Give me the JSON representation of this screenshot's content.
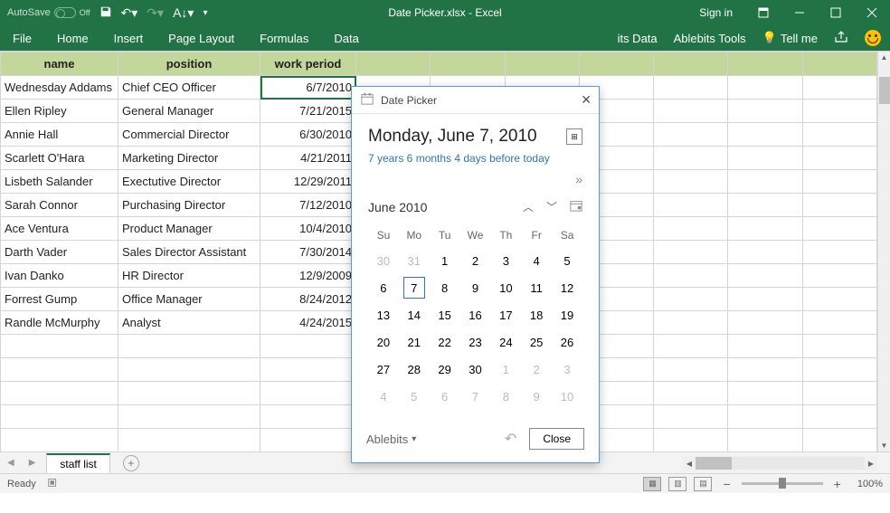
{
  "titlebar": {
    "autosave": "AutoSave",
    "autosave_state": "Off",
    "title": "Date Picker.xlsx - Excel",
    "signin": "Sign in"
  },
  "ribbon": {
    "file": "File",
    "home": "Home",
    "insert": "Insert",
    "page_layout": "Page Layout",
    "formulas": "Formulas",
    "data": "Data",
    "ablebits_data": "its Data",
    "ablebits_tools": "Ablebits Tools",
    "tell_me": "Tell me"
  },
  "sheet": {
    "headers": {
      "name": "name",
      "position": "position",
      "work_period": "work period"
    },
    "rows": [
      {
        "name": "Wednesday Addams",
        "position": "Chief CEO Officer",
        "work_period": "6/7/2010"
      },
      {
        "name": "Ellen Ripley",
        "position": "General Manager",
        "work_period": "7/21/2015"
      },
      {
        "name": "Annie Hall",
        "position": "Commercial Director",
        "work_period": "6/30/2010"
      },
      {
        "name": "Scarlett O'Hara",
        "position": "Marketing Director",
        "work_period": "4/21/2011"
      },
      {
        "name": "Lisbeth Salander",
        "position": "Exectutive Director",
        "work_period": "12/29/2011"
      },
      {
        "name": "Sarah Connor",
        "position": "Purchasing Director",
        "work_period": "7/12/2010"
      },
      {
        "name": "Ace Ventura",
        "position": "Product Manager",
        "work_period": "10/4/2010"
      },
      {
        "name": "Darth Vader",
        "position": "Sales Director Assistant",
        "work_period": "7/30/2014"
      },
      {
        "name": "Ivan Danko",
        "position": "HR Director",
        "work_period": "12/9/2009"
      },
      {
        "name": "Forrest Gump",
        "position": "Office Manager",
        "work_period": "8/24/2012"
      },
      {
        "name": "Randle McMurphy",
        "position": "Analyst",
        "work_period": "4/24/2015"
      }
    ],
    "tab_name": "staff list"
  },
  "datepicker": {
    "title": "Date Picker",
    "selected_date": "Monday, June 7, 2010",
    "relative": "7 years 6 months 4 days before today",
    "month_label": "June 2010",
    "dow": [
      "Su",
      "Mo",
      "Tu",
      "We",
      "Th",
      "Fr",
      "Sa"
    ],
    "weeks": [
      [
        {
          "d": "30",
          "m": true
        },
        {
          "d": "31",
          "m": true
        },
        {
          "d": "1"
        },
        {
          "d": "2"
        },
        {
          "d": "3"
        },
        {
          "d": "4"
        },
        {
          "d": "5"
        }
      ],
      [
        {
          "d": "6"
        },
        {
          "d": "7",
          "sel": true
        },
        {
          "d": "8"
        },
        {
          "d": "9"
        },
        {
          "d": "10"
        },
        {
          "d": "11"
        },
        {
          "d": "12"
        }
      ],
      [
        {
          "d": "13"
        },
        {
          "d": "14"
        },
        {
          "d": "15"
        },
        {
          "d": "16"
        },
        {
          "d": "17"
        },
        {
          "d": "18"
        },
        {
          "d": "19"
        }
      ],
      [
        {
          "d": "20"
        },
        {
          "d": "21"
        },
        {
          "d": "22"
        },
        {
          "d": "23"
        },
        {
          "d": "24"
        },
        {
          "d": "25"
        },
        {
          "d": "26"
        }
      ],
      [
        {
          "d": "27"
        },
        {
          "d": "28"
        },
        {
          "d": "29"
        },
        {
          "d": "30"
        },
        {
          "d": "1",
          "m": true
        },
        {
          "d": "2",
          "m": true
        },
        {
          "d": "3",
          "m": true
        }
      ],
      [
        {
          "d": "4",
          "m": true
        },
        {
          "d": "5",
          "m": true
        },
        {
          "d": "6",
          "m": true
        },
        {
          "d": "7",
          "m": true
        },
        {
          "d": "8",
          "m": true
        },
        {
          "d": "9",
          "m": true
        },
        {
          "d": "10",
          "m": true
        }
      ]
    ],
    "brand": "Ablebits",
    "close": "Close"
  },
  "statusbar": {
    "ready": "Ready",
    "zoom": "100%"
  }
}
